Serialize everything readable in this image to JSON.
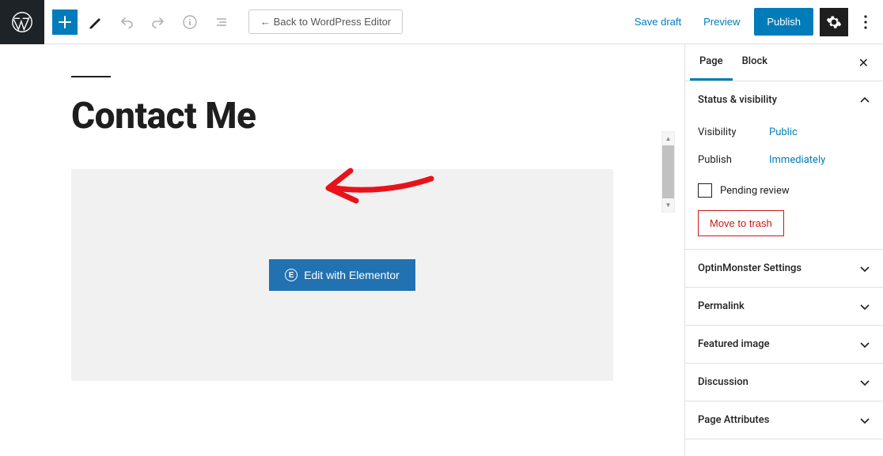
{
  "toolbar": {
    "back_label": "← Back to WordPress Editor",
    "save_draft": "Save draft",
    "preview": "Preview",
    "publish": "Publish"
  },
  "editor": {
    "page_title": "Contact Me",
    "elementor_label": "Edit with Elementor"
  },
  "sidebar": {
    "tabs": {
      "page": "Page",
      "block": "Block"
    },
    "status": {
      "header": "Status & visibility",
      "visibility_label": "Visibility",
      "visibility_value": "Public",
      "publish_label": "Publish",
      "publish_value": "Immediately",
      "pending_label": "Pending review",
      "trash_label": "Move to trash"
    },
    "panels": {
      "optin": "OptinMonster Settings",
      "permalink": "Permalink",
      "featured": "Featured image",
      "discussion": "Discussion",
      "attributes": "Page Attributes"
    }
  }
}
